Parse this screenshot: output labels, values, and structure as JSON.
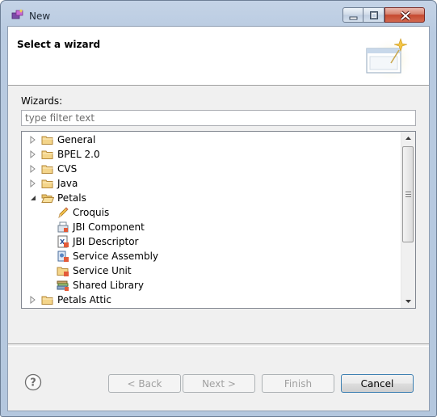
{
  "window": {
    "title": "New",
    "icon": "new-wizard-icon",
    "controls": [
      "minimize-icon",
      "maximize-icon",
      "close-icon"
    ]
  },
  "header": {
    "title": "Select a wizard",
    "image": "wizard-banner-icon"
  },
  "wizards_label": "Wizards:",
  "filter": {
    "value": "",
    "placeholder": "type filter text"
  },
  "tree": {
    "items": [
      {
        "label": "General",
        "icon": "folder-icon",
        "expanded": false,
        "level": 0
      },
      {
        "label": "BPEL 2.0",
        "icon": "folder-icon",
        "expanded": false,
        "level": 0
      },
      {
        "label": "CVS",
        "icon": "folder-icon",
        "expanded": false,
        "level": 0
      },
      {
        "label": "Java",
        "icon": "folder-icon",
        "expanded": false,
        "level": 0
      },
      {
        "label": "Petals",
        "icon": "folder-open-icon",
        "expanded": true,
        "level": 0
      },
      {
        "label": "Croquis",
        "icon": "pencil-icon",
        "level": 1
      },
      {
        "label": "JBI Component",
        "icon": "jbi-component-icon",
        "level": 1
      },
      {
        "label": "JBI Descriptor",
        "icon": "xml-file-icon",
        "level": 1
      },
      {
        "label": "Service Assembly",
        "icon": "service-assembly-icon",
        "level": 1
      },
      {
        "label": "Service Unit",
        "icon": "service-unit-icon",
        "level": 1
      },
      {
        "label": "Shared Library",
        "icon": "shared-library-icon",
        "level": 1
      },
      {
        "label": "Petals Attic",
        "icon": "folder-icon",
        "expanded": false,
        "level": 0
      }
    ]
  },
  "buttons": {
    "back": "< Back",
    "next": "Next >",
    "finish": "Finish",
    "cancel": "Cancel"
  },
  "help_icon": "help-icon"
}
